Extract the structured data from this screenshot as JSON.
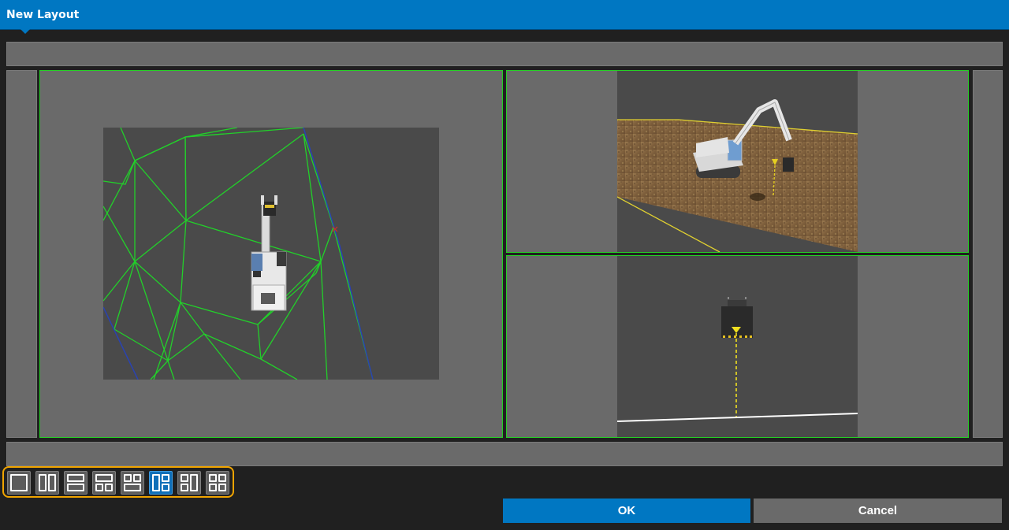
{
  "window": {
    "title": "New Layout"
  },
  "layouts": {
    "selected_index": 5,
    "options": [
      {
        "icon": "layout-single-icon"
      },
      {
        "icon": "layout-two-columns-icon"
      },
      {
        "icon": "layout-two-rows-icon"
      },
      {
        "icon": "layout-one-top-two-bottom-icon"
      },
      {
        "icon": "layout-two-top-one-bottom-icon"
      },
      {
        "icon": "layout-one-left-two-right-icon"
      },
      {
        "icon": "layout-two-left-one-right-icon"
      },
      {
        "icon": "layout-grid-four-icon"
      }
    ]
  },
  "actions": {
    "ok_label": "OK",
    "cancel_label": "Cancel"
  },
  "colors": {
    "accent": "#0077c2",
    "viewport_border": "#25d025",
    "selection_outline": "#f0a400"
  }
}
